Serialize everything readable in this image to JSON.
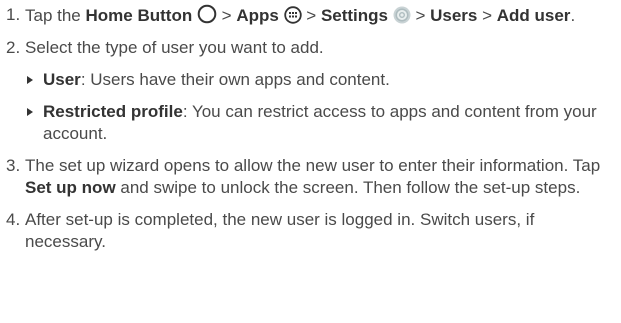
{
  "steps": [
    {
      "num": "1.",
      "prefix": "Tap the ",
      "home_label": "Home Button",
      "sep1": " > ",
      "apps_label": "Apps",
      "sep2": " > ",
      "settings_label": "Settings",
      "sep3": " > ",
      "users_label": "Users",
      "sep4": " > ",
      "add_user_label": "Add user",
      "suffix": "."
    },
    {
      "num": "2.",
      "text": "Select the type of user you want to add.",
      "options": [
        {
          "label": "User",
          "text": ": Users have their own apps and content."
        },
        {
          "label": "Restricted profile",
          "text": ": You can restrict access to apps and content from your account."
        }
      ]
    },
    {
      "num": "3.",
      "text_a": "The set up wizard opens to allow the new user to enter their information. Tap ",
      "setup_label": "Set up now",
      "text_b": " and swipe to unlock the screen. Then follow the set-up steps."
    },
    {
      "num": "4.",
      "text": "After set-up is completed, the new user is logged in. Switch users, if necessary."
    }
  ],
  "icons": {
    "home": "home-circle-icon",
    "apps": "apps-grid-icon",
    "settings": "settings-gear-icon"
  },
  "colors": {
    "text": "#4a4a4a",
    "bold": "#333333",
    "settings_icon": "#b9c6c8"
  }
}
